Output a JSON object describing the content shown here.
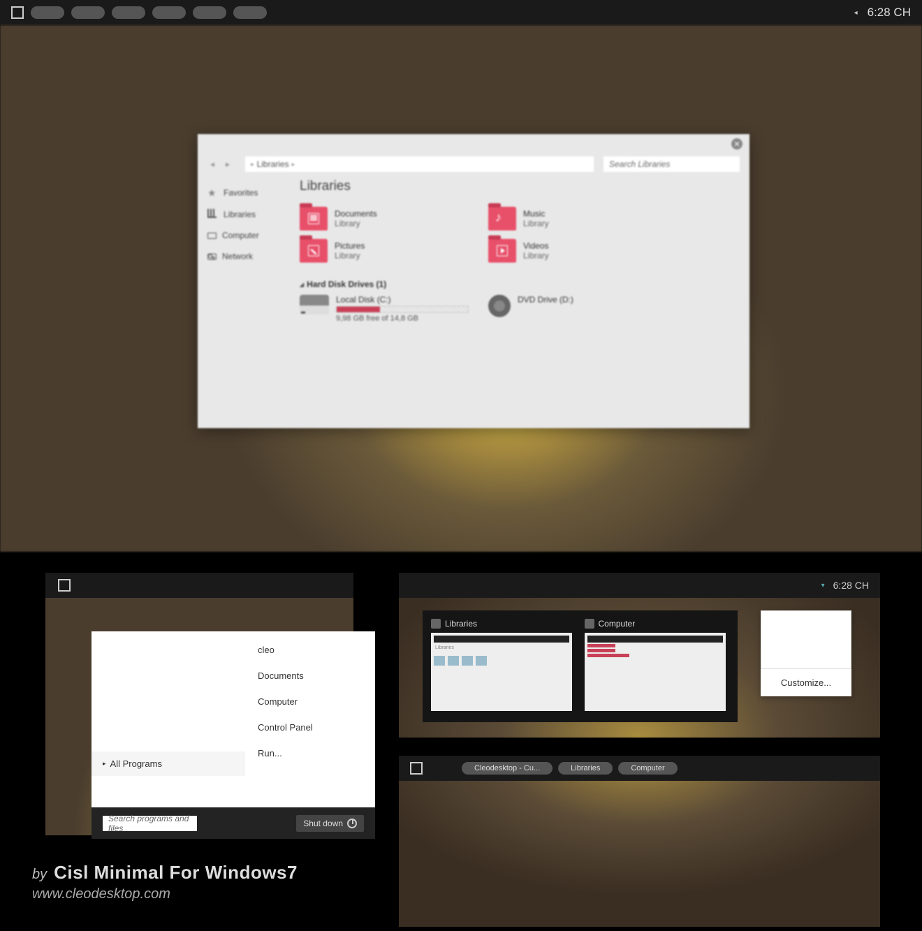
{
  "taskbar": {
    "clock": "6:28 CH"
  },
  "explorer": {
    "breadcrumb": [
      "Libraries"
    ],
    "search_placeholder": "Search Libraries",
    "sidebar": {
      "favorites": "Favorites",
      "libraries": "Libraries",
      "computer": "Computer",
      "network": "Network"
    },
    "title": "Libraries",
    "libs": [
      {
        "name": "Documents",
        "sub": "Library"
      },
      {
        "name": "Music",
        "sub": "Library"
      },
      {
        "name": "Pictures",
        "sub": "Library"
      },
      {
        "name": "Videos",
        "sub": "Library"
      }
    ],
    "drives_header": "Hard Disk Drives (1)",
    "drive_c": {
      "name": "Local Disk (C:)",
      "stat": "9,98 GB free of 14,8 GB",
      "fill_pct": 33
    },
    "drive_d": {
      "name": "DVD Drive (D:)"
    }
  },
  "startmenu": {
    "right_items": [
      "cleo",
      "Documents",
      "Computer",
      "Control Panel",
      "Run..."
    ],
    "all_programs": "All Programs",
    "search_placeholder": "Search programs and files",
    "shutdown": "Shut down"
  },
  "alttab": {
    "items": [
      "Libraries",
      "Computer"
    ],
    "clock": "6:28 CH",
    "customize": "Customize..."
  },
  "taskbar3": {
    "items": [
      "Cleodesktop - Cu...",
      "Libraries",
      "Computer"
    ]
  },
  "footer": {
    "by": "by",
    "title": "Cisl Minimal For Windows7",
    "url": "www.cleodesktop.com"
  }
}
